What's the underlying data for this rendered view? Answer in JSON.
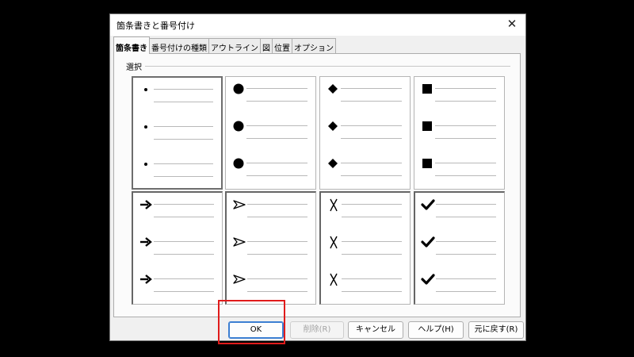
{
  "dialog": {
    "title": "箇条書きと番号付け",
    "close_icon": "close-icon"
  },
  "tabs": [
    {
      "label": "箇条書き",
      "active": true
    },
    {
      "label": "番号付けの種類",
      "active": false
    },
    {
      "label": "アウトライン",
      "active": false
    },
    {
      "label": "図",
      "active": false
    },
    {
      "label": "位置",
      "active": false
    },
    {
      "label": "オプション",
      "active": false
    }
  ],
  "selection": {
    "label": "選択",
    "styles": [
      {
        "icon": "small-dot-bullet-icon",
        "selected": true
      },
      {
        "icon": "large-circle-bullet-icon",
        "selected": false
      },
      {
        "icon": "diamond-bullet-icon",
        "selected": false
      },
      {
        "icon": "square-bullet-icon",
        "selected": false
      },
      {
        "icon": "arrow-bullet-icon",
        "selected": false
      },
      {
        "icon": "arrowhead-bullet-icon",
        "selected": false
      },
      {
        "icon": "x-mark-bullet-icon",
        "selected": false
      },
      {
        "icon": "checkmark-bullet-icon",
        "selected": false
      }
    ]
  },
  "buttons": {
    "ok": "OK",
    "delete": "削除(R)",
    "cancel": "キャンセル",
    "help": "ヘルプ(H)",
    "reset": "元に戻す(R)"
  },
  "colors": {
    "highlight": "#e01b1b",
    "default_button_border": "#3c7fd2"
  }
}
